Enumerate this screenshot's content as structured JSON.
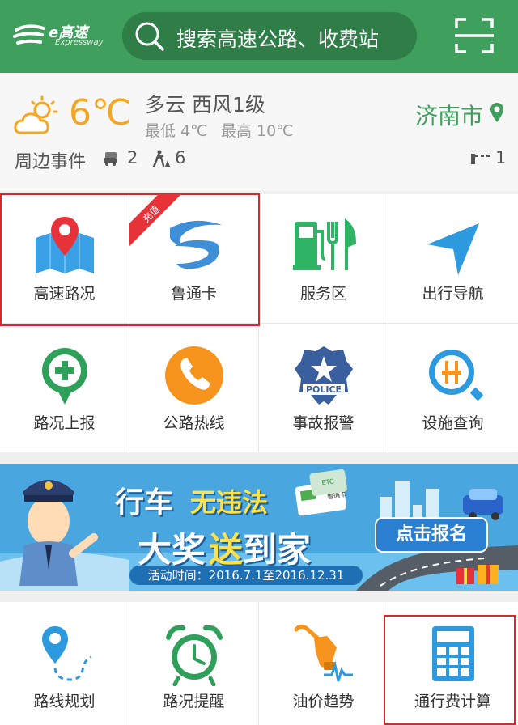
{
  "header": {
    "logo_main": "e高速",
    "logo_sub": "Expressway",
    "search_placeholder": "搜索高速公路、收费站",
    "icons": {
      "search": "search-icon",
      "scan": "scan-icon",
      "logo": "expressway-logo-icon"
    },
    "color": "#3f9f5c"
  },
  "weather": {
    "temperature": "6℃",
    "condition": "多云 西风1级",
    "low": "最低 4℃",
    "high": "最高 10℃",
    "city": "济南市",
    "icon": "partly-cloudy-icon"
  },
  "events": {
    "label": "周边事件",
    "items": [
      {
        "icon": "traffic-jam-icon",
        "count": "2"
      },
      {
        "icon": "roadwork-icon",
        "count": "6"
      },
      {
        "icon": "toll-gate-icon",
        "count": "1"
      }
    ]
  },
  "grid1": [
    {
      "label": "高速路况",
      "icon": "map-pin-icon"
    },
    {
      "label": "鲁通卡",
      "icon": "lutong-card-icon",
      "badge": "充值"
    },
    {
      "label": "服务区",
      "icon": "gas-food-icon"
    },
    {
      "label": "出行导航",
      "icon": "navigation-arrow-icon"
    },
    {
      "label": "路况上报",
      "icon": "report-plus-icon"
    },
    {
      "label": "公路热线",
      "icon": "phone-icon"
    },
    {
      "label": "事故报警",
      "icon": "police-badge-icon"
    },
    {
      "label": "设施查询",
      "icon": "facility-search-icon"
    }
  ],
  "banner": {
    "line1_a": "行车",
    "line1_b": "无违法",
    "line2_a": "大奖",
    "line2_b": "送",
    "line2_c": "到家",
    "date": "活动时间：2016.7.1至2016.12.31",
    "button": "点击报名",
    "card_text": "鲁通卡",
    "etc": "ETC",
    "police": "POLICE"
  },
  "grid2": [
    {
      "label": "路线规划",
      "icon": "route-plan-icon"
    },
    {
      "label": "路况提醒",
      "icon": "alarm-clock-icon"
    },
    {
      "label": "油价趋势",
      "icon": "fuel-price-icon"
    },
    {
      "label": "通行费计算",
      "icon": "calculator-icon"
    }
  ],
  "colors": {
    "brand_green": "#3f9f5c",
    "temp_orange": "#f5a623",
    "highlight_red": "#d42a2a",
    "blue_icon": "#2d9ae0",
    "orange_icon": "#f7941d"
  }
}
